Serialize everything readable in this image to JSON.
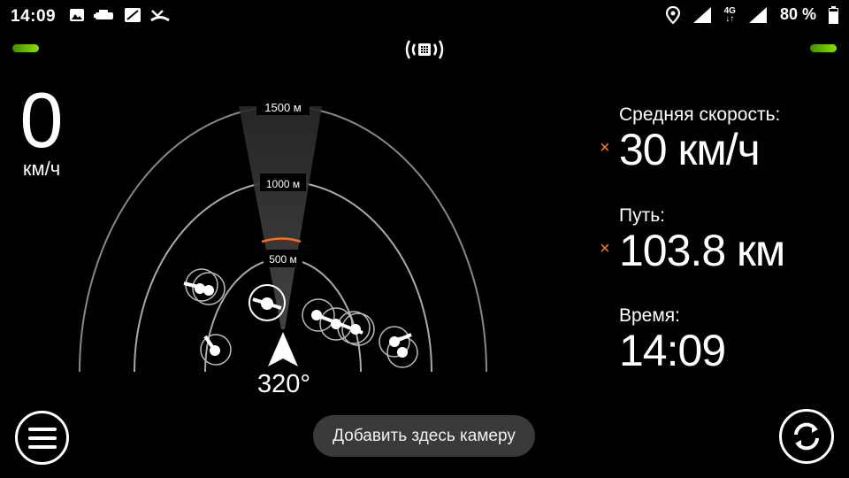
{
  "status_bar": {
    "time": "14:09",
    "left_icons": [
      "image-icon",
      "car-icon",
      "sim-icon",
      "missed-call-icon"
    ],
    "right_icons": [
      "location-icon",
      "signal-icon",
      "network-4g-icon",
      "signal-icon-2",
      "battery-icon"
    ],
    "network": "4G",
    "battery": "80 %"
  },
  "speed": {
    "value": "0",
    "unit": "км/ч"
  },
  "radar": {
    "ring_labels": [
      "500 м",
      "1000 м",
      "1500 м"
    ],
    "heading": "320°",
    "accent_color": "#ff6a1a"
  },
  "stats": {
    "avg_speed_label": "Средняя скорость:",
    "avg_speed_value": "30 км/ч",
    "distance_label": "Путь:",
    "distance_value": "103.8 км",
    "time_label": "Время:",
    "time_value": "14:09",
    "reset_mark": "×"
  },
  "add_camera_label": "Добавить здесь камеру",
  "colors": {
    "gps_green": "#8be000",
    "reset_orange": "#ff7d1a",
    "button_bg": "#3a3a3a"
  }
}
